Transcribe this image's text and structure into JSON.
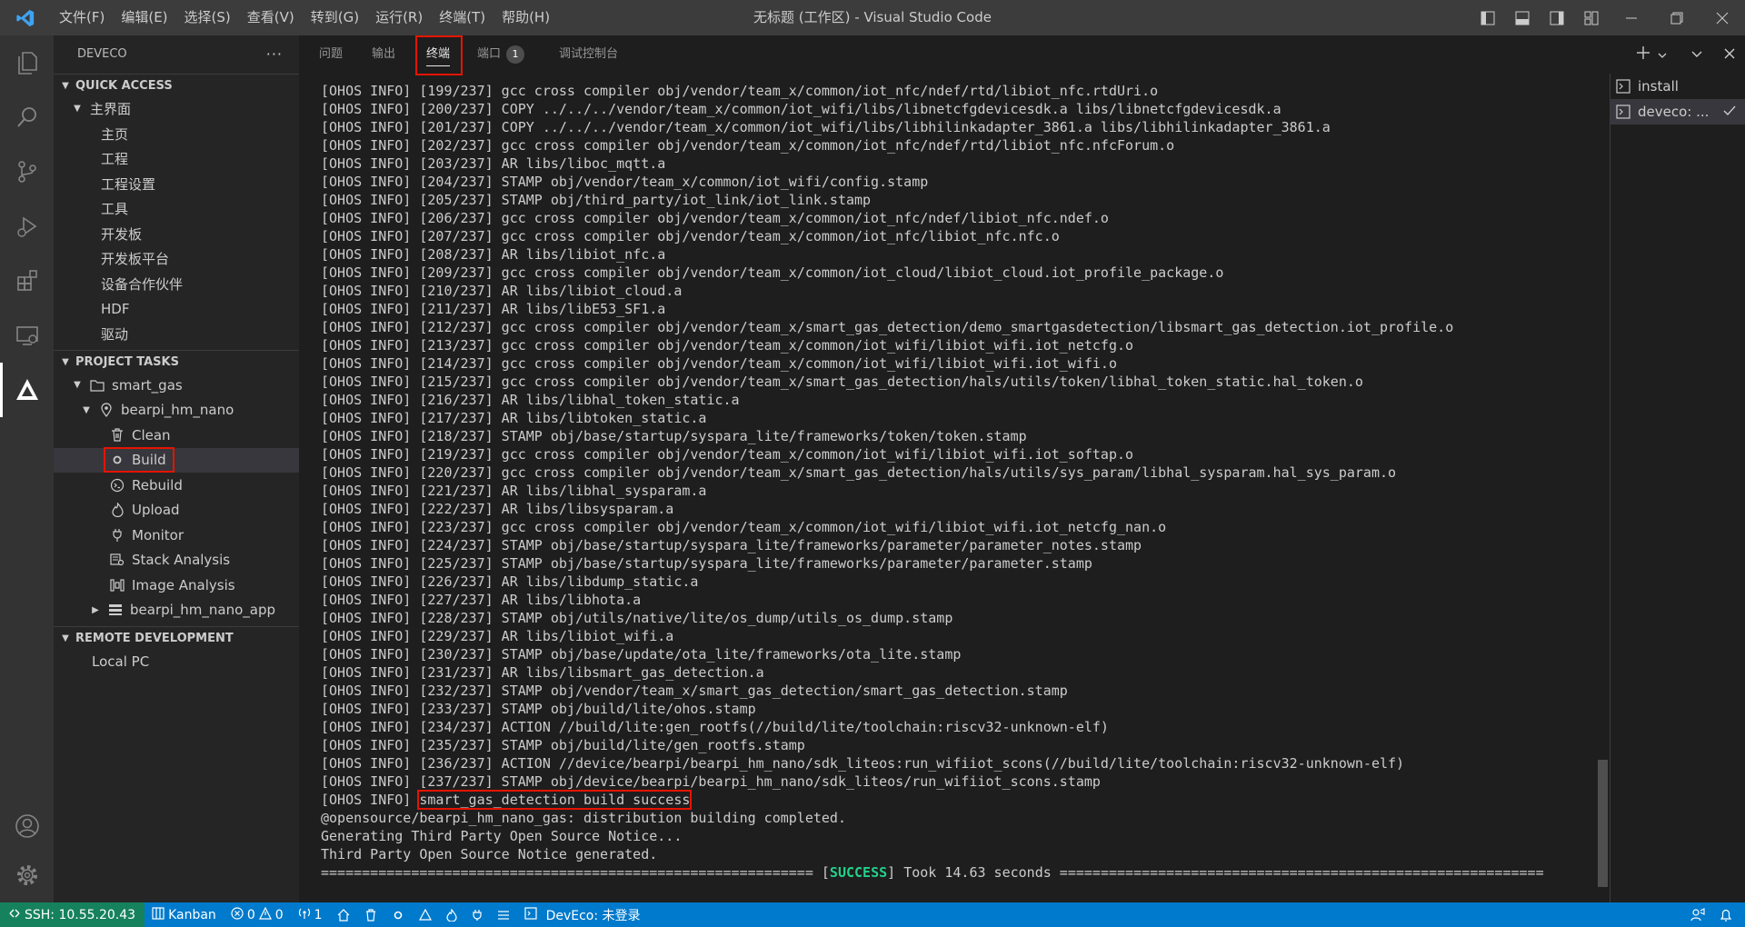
{
  "window": {
    "title": "无标题 (工作区) - Visual Studio Code",
    "menu": [
      "文件(F)",
      "编辑(E)",
      "选择(S)",
      "查看(V)",
      "转到(G)",
      "运行(R)",
      "终端(T)",
      "帮助(H)"
    ]
  },
  "sidebar": {
    "title": "DEVECO",
    "more": "···",
    "quick_access": {
      "header": "QUICK ACCESS",
      "group": "主界面",
      "items": [
        "主页",
        "工程",
        "工程设置",
        "工具",
        "开发板",
        "开发板平台",
        "设备合作伙伴",
        "HDF",
        "驱动"
      ]
    },
    "project_tasks": {
      "header": "PROJECT TASKS",
      "project": "smart_gas",
      "board": "bearpi_hm_nano",
      "tasks": [
        {
          "label": "Clean",
          "icon": "trash-icon"
        },
        {
          "label": "Build",
          "icon": "circle-icon"
        },
        {
          "label": "Rebuild",
          "icon": "rebuild-icon"
        },
        {
          "label": "Upload",
          "icon": "flame-icon"
        },
        {
          "label": "Monitor",
          "icon": "plug-icon"
        },
        {
          "label": "Stack Analysis",
          "icon": "stack-icon"
        },
        {
          "label": "Image Analysis",
          "icon": "image-analysis-icon"
        }
      ],
      "app": "bearpi_hm_nano_app"
    },
    "remote": {
      "header": "REMOTE DEVELOPMENT",
      "item": "Local PC"
    }
  },
  "panel": {
    "tabs": [
      {
        "label": "问题"
      },
      {
        "label": "输出"
      },
      {
        "label": "终端"
      },
      {
        "label": "端口",
        "badge": "1"
      },
      {
        "label": "调试控制台"
      }
    ],
    "terminals": [
      "install",
      "deveco: ..."
    ],
    "lines": [
      "[OHOS INFO] [199/237] gcc cross compiler obj/vendor/team_x/common/iot_nfc/ndef/rtd/libiot_nfc.rtdUri.o",
      "[OHOS INFO] [200/237] COPY ../../../vendor/team_x/common/iot_wifi/libs/libnetcfgdevicesdk.a libs/libnetcfgdevicesdk.a",
      "[OHOS INFO] [201/237] COPY ../../../vendor/team_x/common/iot_wifi/libs/libhilinkadapter_3861.a libs/libhilinkadapter_3861.a",
      "[OHOS INFO] [202/237] gcc cross compiler obj/vendor/team_x/common/iot_nfc/ndef/rtd/libiot_nfc.nfcForum.o",
      "[OHOS INFO] [203/237] AR libs/liboc_mqtt.a",
      "[OHOS INFO] [204/237] STAMP obj/vendor/team_x/common/iot_wifi/config.stamp",
      "[OHOS INFO] [205/237] STAMP obj/third_party/iot_link/iot_link.stamp",
      "[OHOS INFO] [206/237] gcc cross compiler obj/vendor/team_x/common/iot_nfc/ndef/libiot_nfc.ndef.o",
      "[OHOS INFO] [207/237] gcc cross compiler obj/vendor/team_x/common/iot_nfc/libiot_nfc.nfc.o",
      "[OHOS INFO] [208/237] AR libs/libiot_nfc.a",
      "[OHOS INFO] [209/237] gcc cross compiler obj/vendor/team_x/common/iot_cloud/libiot_cloud.iot_profile_package.o",
      "[OHOS INFO] [210/237] AR libs/libiot_cloud.a",
      "[OHOS INFO] [211/237] AR libs/libE53_SF1.a",
      "[OHOS INFO] [212/237] gcc cross compiler obj/vendor/team_x/smart_gas_detection/demo_smartgasdetection/libsmart_gas_detection.iot_profile.o",
      "[OHOS INFO] [213/237] gcc cross compiler obj/vendor/team_x/common/iot_wifi/libiot_wifi.iot_netcfg.o",
      "[OHOS INFO] [214/237] gcc cross compiler obj/vendor/team_x/common/iot_wifi/libiot_wifi.iot_wifi.o",
      "[OHOS INFO] [215/237] gcc cross compiler obj/vendor/team_x/smart_gas_detection/hals/utils/token/libhal_token_static.hal_token.o",
      "[OHOS INFO] [216/237] AR libs/libhal_token_static.a",
      "[OHOS INFO] [217/237] AR libs/libtoken_static.a",
      "[OHOS INFO] [218/237] STAMP obj/base/startup/syspara_lite/frameworks/token/token.stamp",
      "[OHOS INFO] [219/237] gcc cross compiler obj/vendor/team_x/common/iot_wifi/libiot_wifi.iot_softap.o",
      "[OHOS INFO] [220/237] gcc cross compiler obj/vendor/team_x/smart_gas_detection/hals/utils/sys_param/libhal_sysparam.hal_sys_param.o",
      "[OHOS INFO] [221/237] AR libs/libhal_sysparam.a",
      "[OHOS INFO] [222/237] AR libs/libsysparam.a",
      "[OHOS INFO] [223/237] gcc cross compiler obj/vendor/team_x/common/iot_wifi/libiot_wifi.iot_netcfg_nan.o",
      "[OHOS INFO] [224/237] STAMP obj/base/startup/syspara_lite/frameworks/parameter/parameter_notes.stamp",
      "[OHOS INFO] [225/237] STAMP obj/base/startup/syspara_lite/frameworks/parameter/parameter.stamp",
      "[OHOS INFO] [226/237] AR libs/libdump_static.a",
      "[OHOS INFO] [227/237] AR libs/libhota.a",
      "[OHOS INFO] [228/237] STAMP obj/utils/native/lite/os_dump/utils_os_dump.stamp",
      "[OHOS INFO] [229/237] AR libs/libiot_wifi.a",
      "[OHOS INFO] [230/237] STAMP obj/base/update/ota_lite/frameworks/ota_lite.stamp",
      "[OHOS INFO] [231/237] AR libs/libsmart_gas_detection.a",
      "[OHOS INFO] [232/237] STAMP obj/vendor/team_x/smart_gas_detection/smart_gas_detection.stamp",
      "[OHOS INFO] [233/237] STAMP obj/build/lite/ohos.stamp",
      "[OHOS INFO] [234/237] ACTION //build/lite:gen_rootfs(//build/lite/toolchain:riscv32-unknown-elf)",
      "[OHOS INFO] [235/237] STAMP obj/build/lite/gen_rootfs.stamp",
      "[OHOS INFO] [236/237] ACTION //device/bearpi/bearpi_hm_nano/sdk_liteos:run_wifiiot_scons(//build/lite/toolchain:riscv32-unknown-elf)",
      "[OHOS INFO] [237/237] STAMP obj/device/bearpi/bearpi_hm_nano/sdk_liteos/run_wifiiot_scons.stamp"
    ],
    "success_prefix": "[OHOS INFO] ",
    "success_msg": "smart_gas_detection build success",
    "after_lines": [
      "@opensource/bearpi_hm_nano_gas: distribution building completed.",
      "Generating Third Party Open Source Notice...",
      "Third Party Open Source Notice generated."
    ],
    "final": {
      "left": "============================================================ [",
      "status": "SUCCESS",
      "right": "] Took 14.63 seconds ==========================================================="
    }
  },
  "statusbar": {
    "remote": "SSH: 10.55.20.43",
    "kanban": "Kanban",
    "errors": "0",
    "warnings": "0",
    "ports": "1",
    "deveco": "DevEco: 未登录"
  },
  "colors": {
    "accent": "#007acc",
    "remote": "#16825d",
    "success": "#23d18b",
    "highlight": "#e51400"
  }
}
